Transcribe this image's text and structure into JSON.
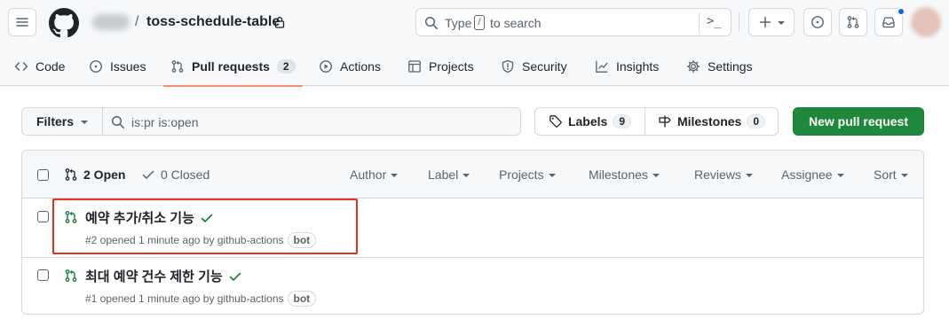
{
  "repo": {
    "separator": "/",
    "name": "toss-schedule-table"
  },
  "search": {
    "placeholder_before": "Type",
    "key": "/",
    "placeholder_after": "to search",
    "command_glyph": ">_"
  },
  "nav": {
    "tabs": [
      {
        "label": "Code",
        "icon": "code-icon"
      },
      {
        "label": "Issues",
        "icon": "issue-icon"
      },
      {
        "label": "Pull requests",
        "icon": "git-pull-request-icon",
        "count": "2",
        "active": true
      },
      {
        "label": "Actions",
        "icon": "play-icon"
      },
      {
        "label": "Projects",
        "icon": "table-icon"
      },
      {
        "label": "Security",
        "icon": "shield-icon"
      },
      {
        "label": "Insights",
        "icon": "graph-icon"
      },
      {
        "label": "Settings",
        "icon": "gear-icon"
      }
    ]
  },
  "filterbar": {
    "filters_label": "Filters",
    "query": "is:pr is:open",
    "labels_label": "Labels",
    "labels_count": "9",
    "milestones_label": "Milestones",
    "milestones_count": "0",
    "new_pr_label": "New pull request"
  },
  "list": {
    "open_label": "2 Open",
    "closed_label": "0 Closed",
    "sorters": [
      "Author",
      "Label",
      "Projects",
      "Milestones",
      "Reviews",
      "Assignee",
      "Sort"
    ],
    "items": [
      {
        "title": "예약 추가/취소 기능",
        "meta": "#2 opened 1 minute ago by github-actions",
        "badge": "bot",
        "status": "success"
      },
      {
        "title": "최대 예약 건수 제한 기능",
        "meta": "#1 opened 1 minute ago by github-actions",
        "badge": "bot",
        "status": "success"
      }
    ]
  },
  "colors": {
    "accent_green": "#1f883d",
    "tab_underline": "#fd8c73",
    "open_pr_green": "#1a7f37",
    "highlight": "#e0321c",
    "notification_dot": "#0969da"
  }
}
